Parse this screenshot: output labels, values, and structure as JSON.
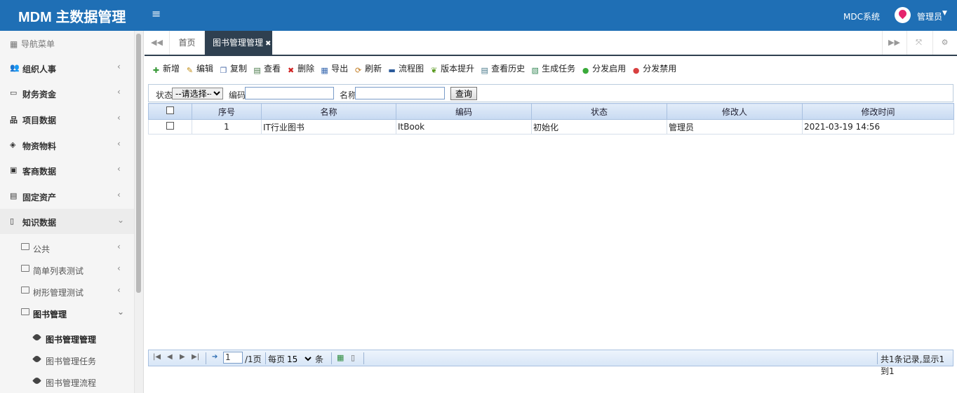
{
  "app": {
    "title": "MDM 主数据管理",
    "system_link": "MDC系统",
    "user_name": "管理员"
  },
  "sidebar": {
    "header": "导航菜单",
    "items": [
      {
        "label": "组织人事",
        "icon": "users-icon",
        "glyph": "👥"
      },
      {
        "label": "财务资金",
        "icon": "credit-card-icon",
        "glyph": "▭"
      },
      {
        "label": "项目数据",
        "icon": "sitemap-icon",
        "glyph": "品"
      },
      {
        "label": "物资物料",
        "icon": "cubes-icon",
        "glyph": "◈"
      },
      {
        "label": "客商数据",
        "icon": "briefcase-icon",
        "glyph": "▣"
      },
      {
        "label": "固定资产",
        "icon": "archive-icon",
        "glyph": "▤"
      },
      {
        "label": "知识数据",
        "icon": "file-icon",
        "glyph": "▯"
      }
    ],
    "sub_items": [
      {
        "label": "公共"
      },
      {
        "label": "简单列表测试"
      },
      {
        "label": "树形管理测试"
      },
      {
        "label": "图书管理"
      }
    ],
    "leaf_items": [
      {
        "label": "图书管理管理"
      },
      {
        "label": "图书管理任务"
      },
      {
        "label": "图书管理流程"
      }
    ]
  },
  "tabs": {
    "home": "首页",
    "active": "图书管理管理"
  },
  "toolbar": [
    {
      "label": "新增",
      "icon": "add-icon",
      "glyph": "✚",
      "color": "#3a9a3a"
    },
    {
      "label": "编辑",
      "icon": "edit-icon",
      "glyph": "✎",
      "color": "#c08a10"
    },
    {
      "label": "复制",
      "icon": "copy-icon",
      "glyph": "❐",
      "color": "#4a6aa8"
    },
    {
      "label": "查看",
      "icon": "view-icon",
      "glyph": "▤",
      "color": "#4a7a4a"
    },
    {
      "label": "删除",
      "icon": "delete-icon",
      "glyph": "✖",
      "color": "#d02020"
    },
    {
      "label": "导出",
      "icon": "export-icon",
      "glyph": "▦",
      "color": "#3a6ab0"
    },
    {
      "label": "刷新",
      "icon": "refresh-icon",
      "glyph": "⟳",
      "color": "#c07a20"
    },
    {
      "label": "流程图",
      "icon": "flowchart-icon",
      "glyph": "▬",
      "color": "#2a5a9a"
    },
    {
      "label": "版本提升",
      "icon": "upgrade-icon",
      "glyph": "❦",
      "color": "#5a9a20"
    },
    {
      "label": "查看历史",
      "icon": "history-icon",
      "glyph": "▤",
      "color": "#4a7a8a"
    },
    {
      "label": "生成任务",
      "icon": "task-icon",
      "glyph": "▧",
      "color": "#3a8a5a"
    },
    {
      "label": "分发启用",
      "icon": "enable-icon",
      "glyph": "●",
      "color": "#3aaa3a"
    },
    {
      "label": "分发禁用",
      "icon": "disable-icon",
      "glyph": "●",
      "color": "#d84040"
    }
  ],
  "filter": {
    "status_label": "状态",
    "status_selected": "--请选择--",
    "code_label": "编码",
    "name_label": "名称",
    "query_button": "查询"
  },
  "grid": {
    "columns": [
      "序号",
      "名称",
      "编码",
      "状态",
      "修改人",
      "修改时间"
    ],
    "rows": [
      {
        "index": "1",
        "name": "IT行业图书",
        "code": "ItBook",
        "status": "初始化",
        "modifier": "管理员",
        "modified_time": "2021-03-19 14:56"
      }
    ]
  },
  "pager": {
    "current_page": "1",
    "total_pages": "/1页",
    "per_page_label": "每页",
    "per_page_value": "15",
    "per_page_unit": "条",
    "summary": "共1条记录,显示1到1"
  }
}
